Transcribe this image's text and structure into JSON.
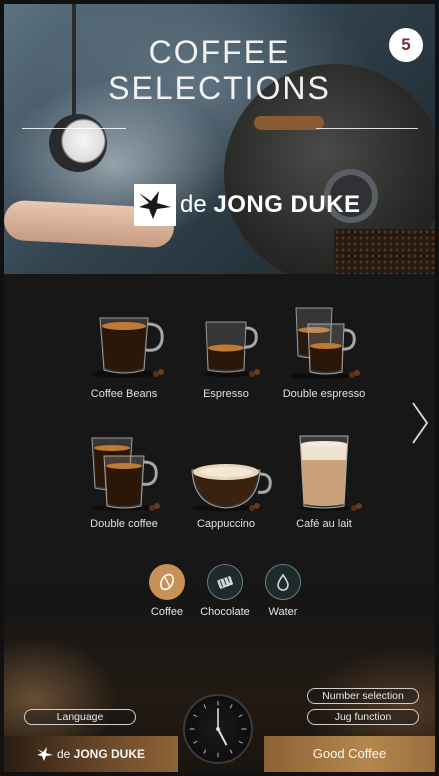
{
  "header": {
    "title_line1": "COFFEE",
    "title_line2": "SELECTIONS",
    "page_badge": "5",
    "brand_prefix": "de ",
    "brand_name": "JONG DUKE"
  },
  "products": [
    {
      "label": "Coffee Beans",
      "icon": "coffee-cup-icon"
    },
    {
      "label": "Espresso",
      "icon": "espresso-cup-icon"
    },
    {
      "label": "Double espresso",
      "icon": "double-espresso-icon"
    },
    {
      "label": "Double coffee",
      "icon": "double-coffee-icon"
    },
    {
      "label": "Cappuccino",
      "icon": "cappuccino-cup-icon"
    },
    {
      "label": "Café au lait",
      "icon": "latte-glass-icon"
    }
  ],
  "order_types": [
    {
      "label": "Coffee",
      "icon": "coffee-bean-icon",
      "active": true
    },
    {
      "label": "Chocolate",
      "icon": "chocolate-icon",
      "active": false
    },
    {
      "label": "Water",
      "icon": "water-drop-icon",
      "active": false
    }
  ],
  "controls": {
    "language": "Language",
    "number_selection": "Number selection",
    "jug_function": "Jug function"
  },
  "footer": {
    "brand_prefix": "de ",
    "brand_name": "JONG DUKE",
    "slogan": "Good Coffee"
  },
  "colors": {
    "accent": "#c89257",
    "badge_text": "#7a2b3c",
    "background": "#171717"
  }
}
